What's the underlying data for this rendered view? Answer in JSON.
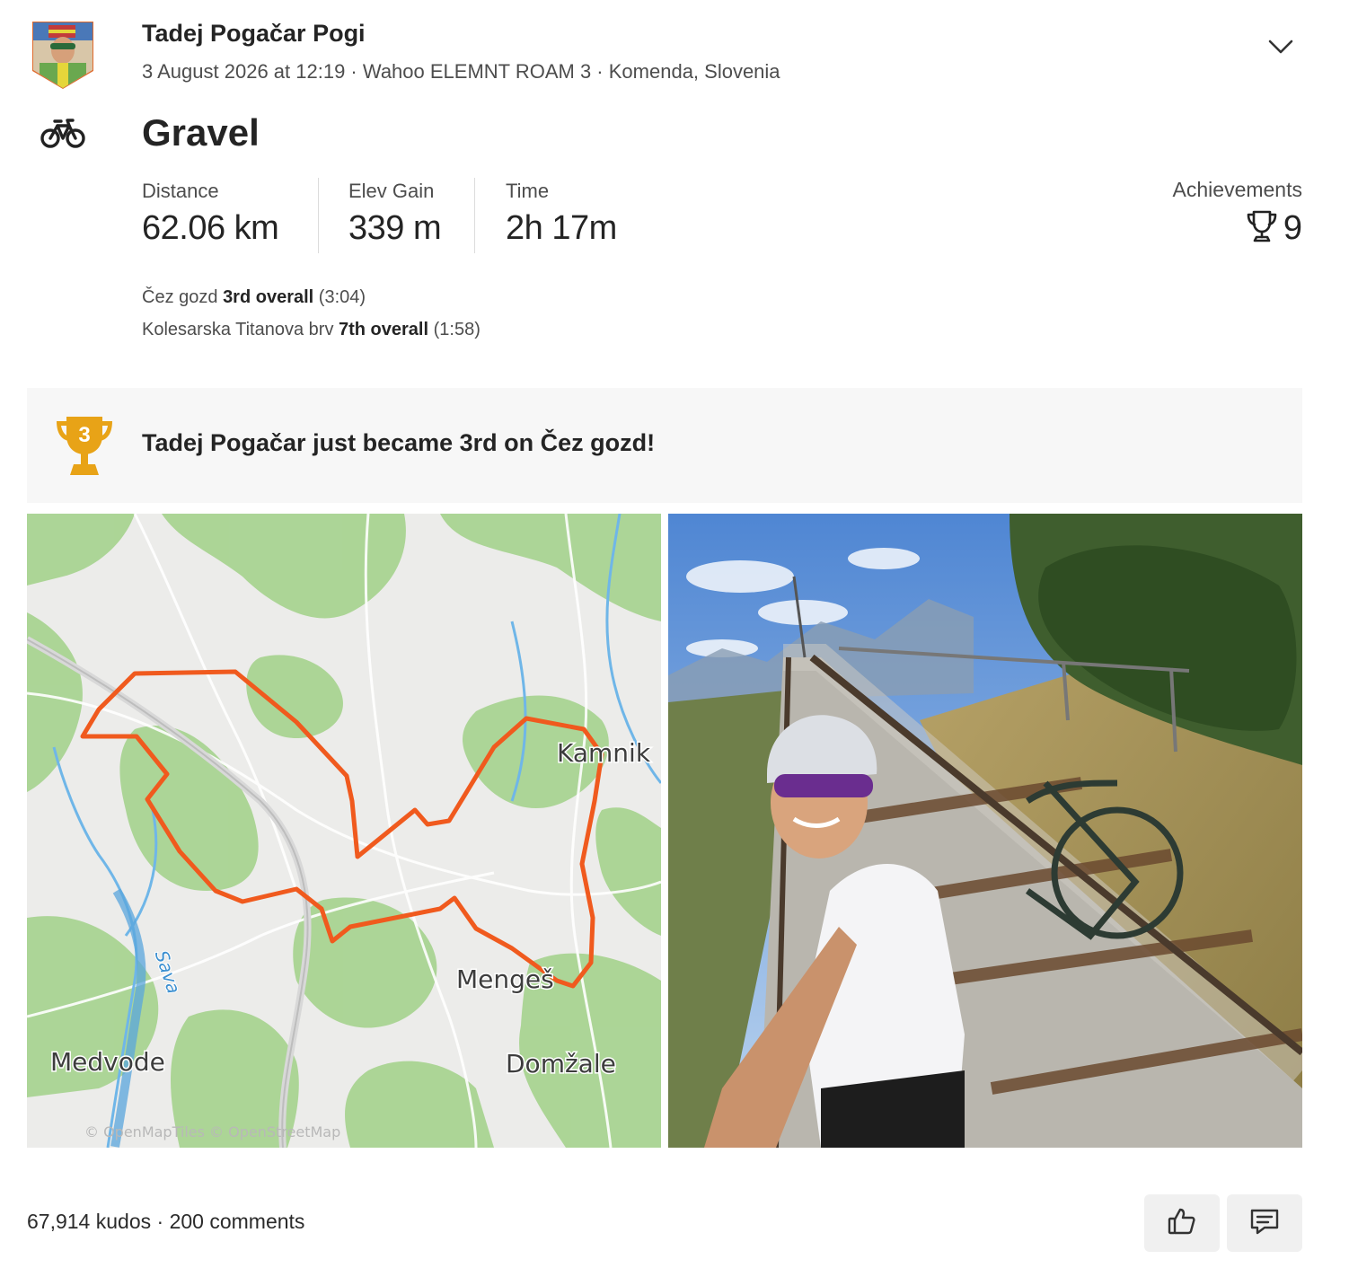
{
  "header": {
    "athlete_name": "Tadej Pogačar Pogi",
    "date": "3 August 2026 at 12:19",
    "device": "Wahoo ELEMNT ROAM 3",
    "location": "Komenda, Slovenia",
    "separator": " · ",
    "menu_icon": "chevron-down-icon",
    "sport_icon": "bike-icon",
    "activity_title": "Gravel"
  },
  "stats": [
    {
      "label": "Distance",
      "value": "62.06 km"
    },
    {
      "label": "Elev Gain",
      "value": "339 m"
    },
    {
      "label": "Time",
      "value": "2h 17m"
    }
  ],
  "achievements": {
    "label": "Achievements",
    "count": "9",
    "icon": "trophy-icon"
  },
  "segments": [
    {
      "name": "Čez gozd",
      "rank": "3rd overall",
      "time": "(3:04)"
    },
    {
      "name": "Kolesarska Titanova brv",
      "rank": "7th overall",
      "time": "(1:58)"
    }
  ],
  "banner": {
    "text": "Tadej Pogačar just became 3rd on Čez gozd!",
    "trophy_rank": "3",
    "trophy_color": "#e8a317"
  },
  "map": {
    "labels": [
      "Kamnik",
      "Mengeš",
      "Domžale",
      "Medvode",
      "Sava"
    ],
    "attribution": "© OpenMapTiles © OpenStreetMap",
    "route_color": "#f05a1e"
  },
  "footer": {
    "kudos": "67,914 kudos",
    "comments": "200 comments",
    "separator": " · ",
    "kudos_button_icon": "thumbs-up-icon",
    "comment_button_icon": "comment-icon"
  },
  "colors": {
    "accent": "#fc4c02",
    "banner_bg": "#f7f7f7",
    "button_bg": "#f0f0f0"
  }
}
